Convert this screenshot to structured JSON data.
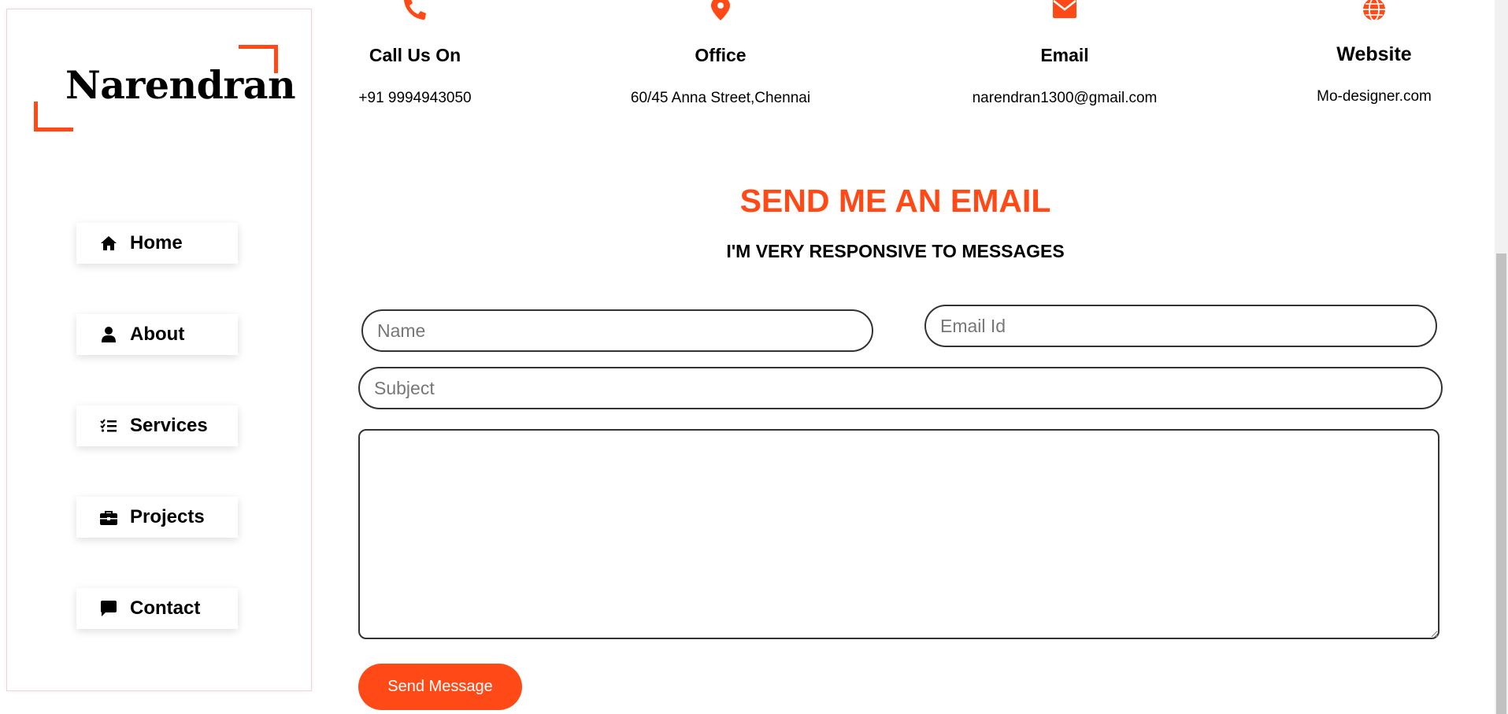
{
  "brand": {
    "name": "Narendran",
    "accent_color": "#ff4a17"
  },
  "nav": {
    "items": [
      {
        "label": "Home",
        "icon": "home-icon"
      },
      {
        "label": "About",
        "icon": "user-icon"
      },
      {
        "label": "Services",
        "icon": "list-check-icon"
      },
      {
        "label": "Projects",
        "icon": "briefcase-icon"
      },
      {
        "label": "Contact",
        "icon": "message-icon"
      }
    ]
  },
  "contact_info": [
    {
      "title": "Call Us On",
      "value": "+91 9994943050",
      "icon": "phone-icon"
    },
    {
      "title": "Office",
      "value": "60/45 Anna Street,Chennai",
      "icon": "location-pin-icon"
    },
    {
      "title": "Email",
      "value": "narendran1300@gmail.com",
      "icon": "envelope-icon"
    },
    {
      "title": "Website",
      "value": "Mo-designer.com",
      "icon": "globe-icon"
    }
  ],
  "section": {
    "title": "SEND ME AN EMAIL",
    "subtitle": "I'M VERY RESPONSIVE TO MESSAGES"
  },
  "form": {
    "name_placeholder": "Name",
    "email_placeholder": "Email Id",
    "subject_placeholder": "Subject",
    "message_placeholder": "",
    "submit_label": "Send Message"
  }
}
